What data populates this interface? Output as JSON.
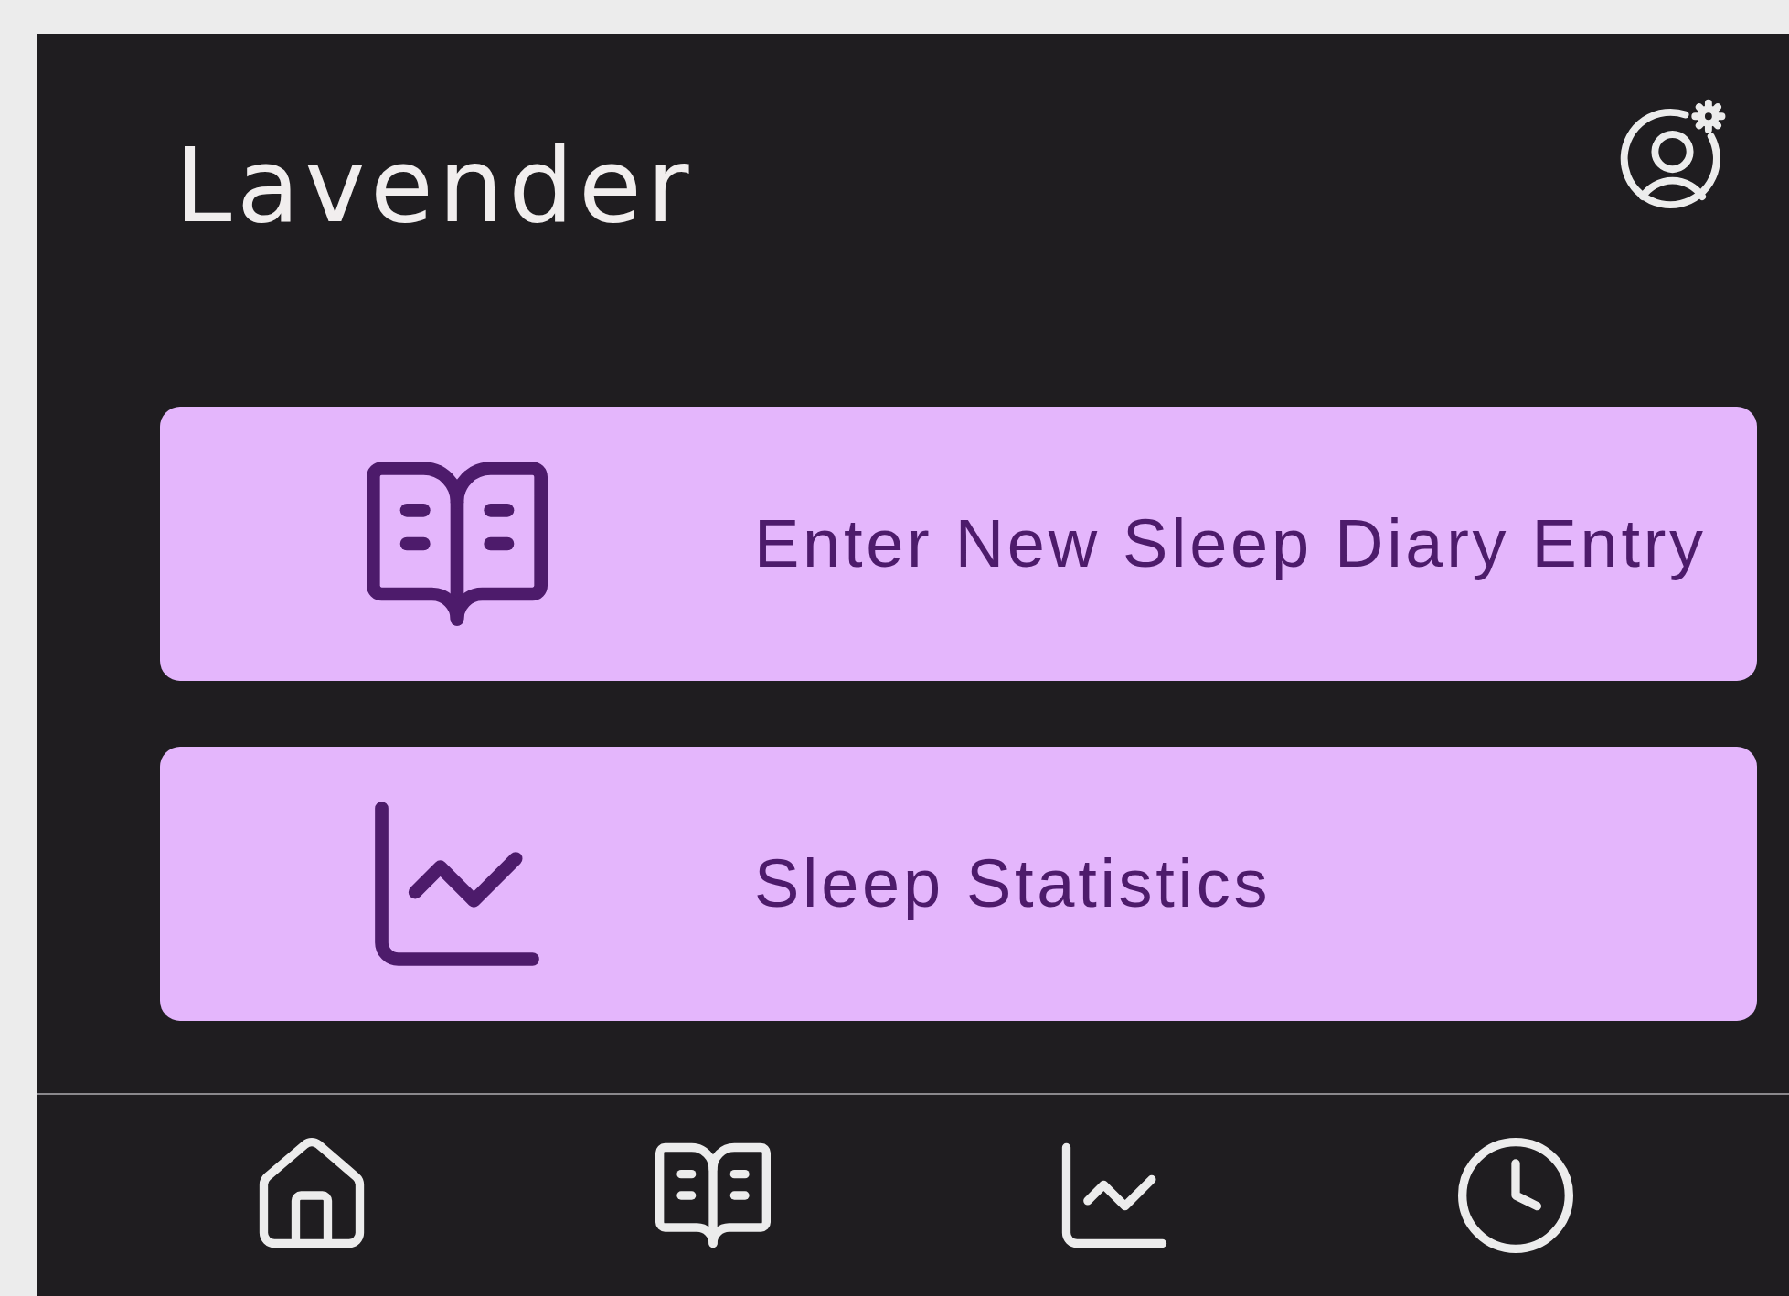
{
  "header": {
    "title": "Lavender"
  },
  "actions": [
    {
      "kind": "diary",
      "label": "Enter New Sleep Diary Entry"
    },
    {
      "kind": "stats",
      "label": "Sleep Statistics"
    }
  ],
  "nav": [
    {
      "kind": "home"
    },
    {
      "kind": "diary"
    },
    {
      "kind": "stats"
    },
    {
      "kind": "history"
    }
  ]
}
